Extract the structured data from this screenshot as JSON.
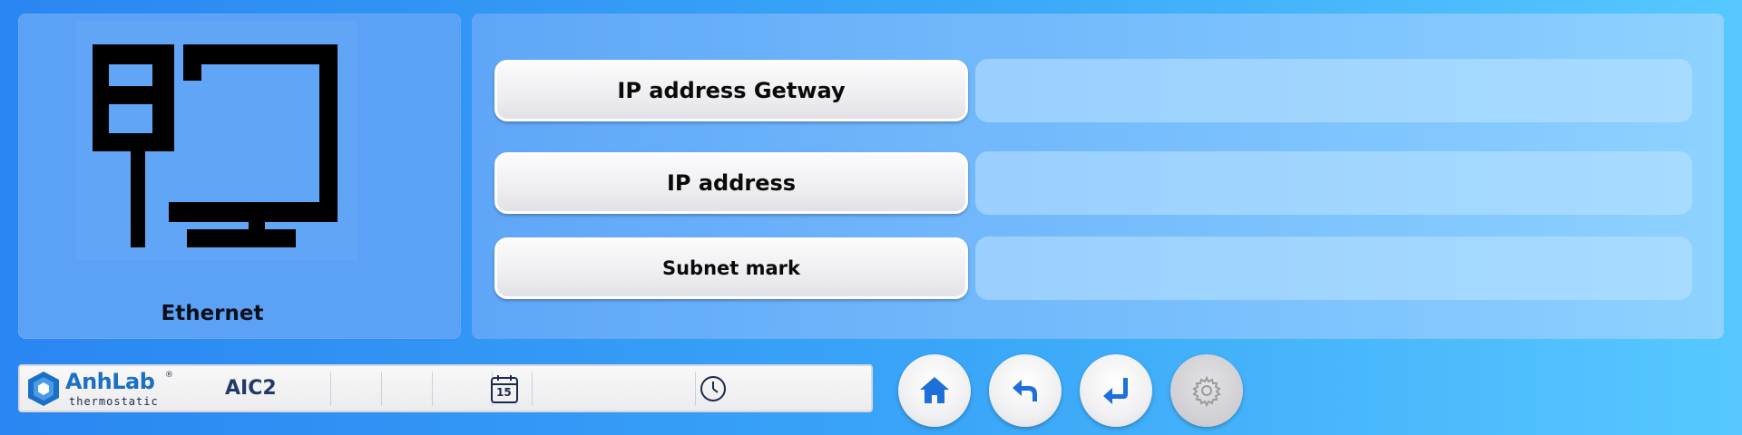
{
  "left_panel": {
    "label": "Ethernet",
    "icon": "ethernet-monitor-icon"
  },
  "fields": [
    {
      "label": "IP address Getway",
      "value": ""
    },
    {
      "label": "IP address",
      "value": ""
    },
    {
      "label": "Subnet mark",
      "value": ""
    }
  ],
  "status_bar": {
    "brand": "AnhLab",
    "brand_mark": "®",
    "brand_sub": "thermostatic",
    "device": "AIC2",
    "calendar_day": "15",
    "calendar_icon": "calendar-icon",
    "clock_icon": "clock-icon"
  },
  "nav_buttons": [
    {
      "icon": "home-icon",
      "enabled": true
    },
    {
      "icon": "back-icon",
      "enabled": true
    },
    {
      "icon": "enter-icon",
      "enabled": true
    },
    {
      "icon": "gear-icon",
      "enabled": false
    }
  ],
  "colors": {
    "accent": "#1e6fd9",
    "panel": "#5ba1f6",
    "brand": "#1b6fc4"
  }
}
